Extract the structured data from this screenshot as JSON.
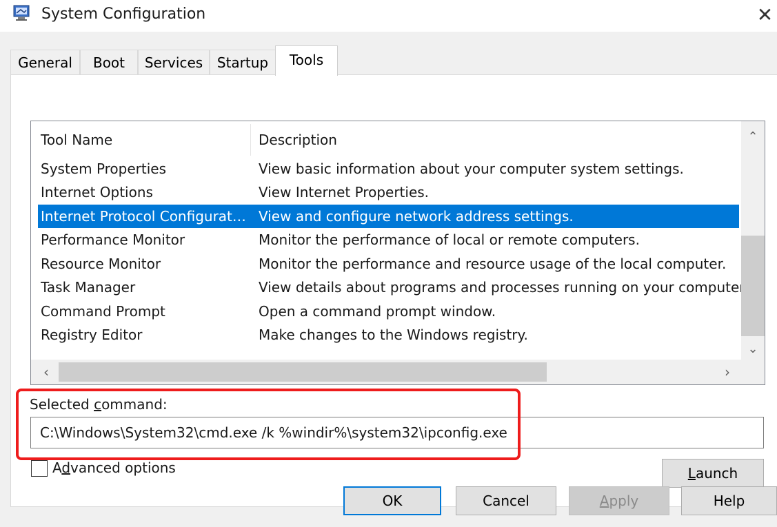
{
  "window": {
    "title": "System Configuration",
    "close_glyph": "✕",
    "icon": "msconfig-icon"
  },
  "tabs": [
    {
      "label": "General",
      "active": false
    },
    {
      "label": "Boot",
      "active": false
    },
    {
      "label": "Services",
      "active": false
    },
    {
      "label": "Startup",
      "active": false
    },
    {
      "label": "Tools",
      "active": true
    }
  ],
  "tools_list": {
    "columns": [
      "Tool Name",
      "Description"
    ],
    "rows": [
      {
        "name": "System Properties",
        "description": "View basic information about your computer system settings."
      },
      {
        "name": "Internet Options",
        "description": "View Internet Properties."
      },
      {
        "name": "Internet Protocol Configurat…",
        "description": "View and configure network address settings.",
        "selected": true
      },
      {
        "name": "Performance Monitor",
        "description": "Monitor the performance of local or remote computers."
      },
      {
        "name": "Resource Monitor",
        "description": "Monitor the performance and resource usage of the local computer."
      },
      {
        "name": "Task Manager",
        "description": "View details about programs and processes running on your computer."
      },
      {
        "name": "Command Prompt",
        "description": "Open a command prompt window."
      },
      {
        "name": "Registry Editor",
        "description": "Make changes to the Windows registry."
      }
    ],
    "scroll_up_glyph": "⌃",
    "scroll_down_glyph": "⌄",
    "scroll_left_glyph": "‹",
    "scroll_right_glyph": "›"
  },
  "selected_command": {
    "label_before": "Selected ",
    "label_accel": "c",
    "label_after": "ommand:",
    "value": "C:\\Windows\\System32\\cmd.exe /k %windir%\\system32\\ipconfig.exe"
  },
  "advanced_options": {
    "label_before": "A",
    "label_accel": "d",
    "label_after": "vanced options",
    "checked": false
  },
  "buttons": {
    "launch": {
      "accel": "L",
      "rest": "aunch"
    },
    "ok": "OK",
    "cancel": "Cancel",
    "apply": {
      "accel": "A",
      "rest": "pply",
      "disabled": true
    },
    "help": "Help"
  },
  "colors": {
    "selection": "#0078d7",
    "highlight_box": "#ee1c1c",
    "panel_bg": "#f0f0f0"
  }
}
